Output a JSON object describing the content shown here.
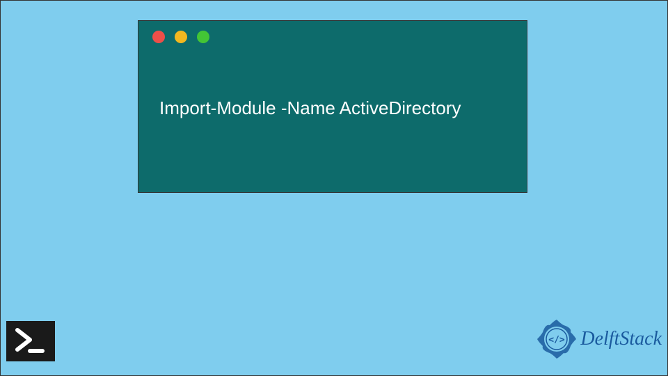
{
  "terminal": {
    "code": "Import-Module -Name ActiveDirectory",
    "traffic_lights": {
      "red": "close-icon",
      "yellow": "minimize-icon",
      "green": "maximize-icon"
    }
  },
  "branding": {
    "powershell_icon": "powershell-icon",
    "logo_text": "DelftStack",
    "logo_badge": "delftstack-badge-icon"
  },
  "colors": {
    "background": "#7fcdee",
    "terminal_bg": "#0d6b6b",
    "terminal_text": "#ffffff",
    "brand_blue": "#1a5a9e"
  }
}
